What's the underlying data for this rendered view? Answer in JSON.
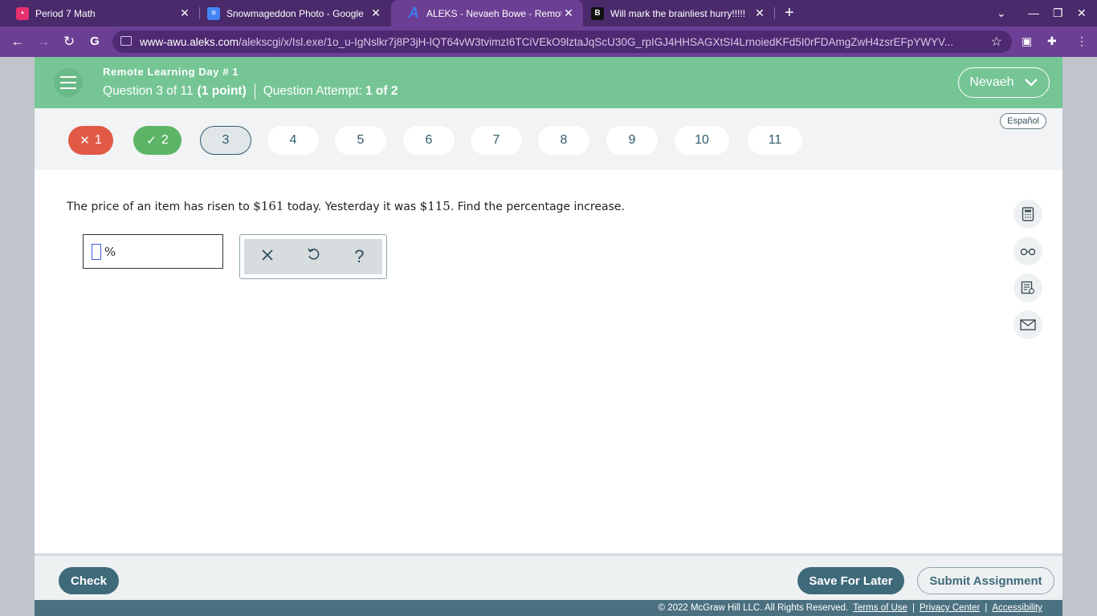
{
  "browser": {
    "tabs": [
      {
        "title": "Period 7 Math",
        "favicon": "classroom-icon",
        "active": false
      },
      {
        "title": "Snowmageddon Photo - Google",
        "favicon": "docs-icon",
        "active": false
      },
      {
        "title": "ALEKS - Nevaeh Bowe - Remote L",
        "favicon": "aleks-icon",
        "active": true
      },
      {
        "title": "Will mark the brainliest hurry!!!!!",
        "favicon": "brainly-icon",
        "active": false
      }
    ],
    "url_host": "www-awu.aleks.com",
    "url_path": "/alekscgi/x/Isl.exe/1o_u-IgNslkr7j8P3jH-lQT64vW3tvimzI6TCiVEkO9lztaJqScU30G_rpIGJ4HHSAGXtSI4LrnoiedKFd5I0rFDAmgZwH4zsrEFpYWYV..."
  },
  "header": {
    "assignment_title": "Remote Learning Day # 1",
    "question_label": "Question 3 of 11",
    "points": "(1 point)",
    "attempt_label": "Question Attempt:",
    "attempt_value": "1 of 2",
    "user_name": "Nevaeh"
  },
  "question_nav": {
    "language_link": "Español",
    "items": [
      {
        "label": "1",
        "status": "wrong"
      },
      {
        "label": "2",
        "status": "correct"
      },
      {
        "label": "3",
        "status": "current"
      },
      {
        "label": "4",
        "status": "unanswered"
      },
      {
        "label": "5",
        "status": "unanswered"
      },
      {
        "label": "6",
        "status": "unanswered"
      },
      {
        "label": "7",
        "status": "unanswered"
      },
      {
        "label": "8",
        "status": "unanswered"
      },
      {
        "label": "9",
        "status": "unanswered"
      },
      {
        "label": "10",
        "status": "unanswered"
      },
      {
        "label": "11",
        "status": "unanswered"
      }
    ]
  },
  "problem": {
    "text_1": "The price of an item has risen to ",
    "value_1": "$161",
    "text_2": " today. Yesterday it was ",
    "value_2": "$115",
    "text_3": ". Find the percentage increase."
  },
  "answer": {
    "value": "",
    "unit": "%"
  },
  "toolpad": {
    "clear_icon": "close-icon",
    "undo_icon": "undo-icon",
    "help_label": "?"
  },
  "side_tools": [
    "calculator-icon",
    "glasses-icon",
    "notes-icon",
    "mail-icon"
  ],
  "footer": {
    "check_label": "Check",
    "save_label": "Save For Later",
    "submit_label": "Submit Assignment",
    "copyright": "© 2022 McGraw Hill LLC. All Rights Reserved.",
    "terms": "Terms of Use",
    "privacy": "Privacy Center",
    "accessibility": "Accessibility"
  },
  "colors": {
    "header_green": "#75c595",
    "chrome_purple": "#6b3f93",
    "wrong_red": "#e05a46",
    "correct_green": "#5cb566",
    "primary_teal": "#3f6a7a"
  }
}
